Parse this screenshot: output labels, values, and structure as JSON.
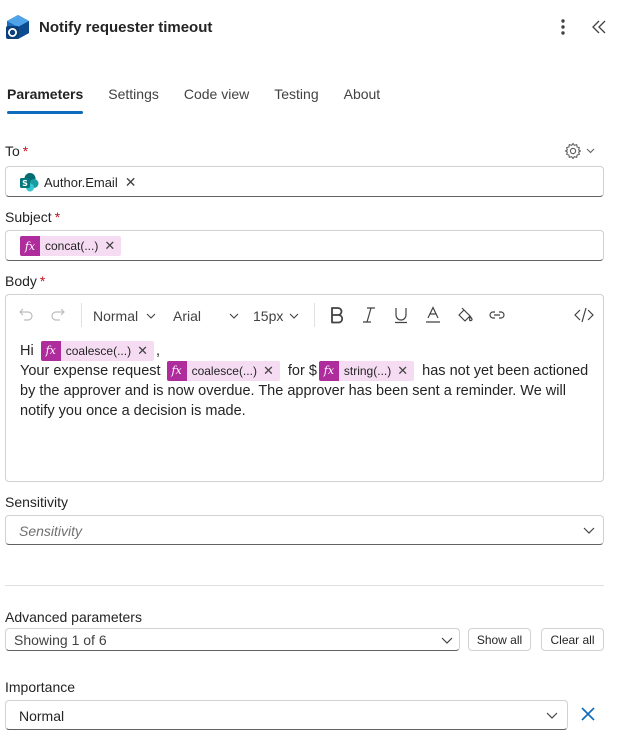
{
  "header": {
    "title": "Notify requester timeout"
  },
  "tabs": [
    {
      "label": "Parameters",
      "active": true
    },
    {
      "label": "Settings",
      "active": false
    },
    {
      "label": "Code view",
      "active": false
    },
    {
      "label": "Testing",
      "active": false
    },
    {
      "label": "About",
      "active": false
    }
  ],
  "to": {
    "label": "To",
    "required": "*",
    "token": "Author.Email"
  },
  "subject": {
    "label": "Subject",
    "required": "*",
    "token": "concat(...)"
  },
  "body": {
    "label": "Body",
    "required": "*",
    "toolbar": {
      "paragraph_style": "Normal",
      "font": "Arial",
      "font_size": "15px"
    },
    "line1_prefix": "Hi",
    "line1_token": "coalesce(...)",
    "line1_suffix": ",",
    "line2_prefix": "Your expense request",
    "line2_token1": "coalesce(...)",
    "line2_mid": "for $",
    "line2_token2": "string(...)",
    "line2_suffix": "has not yet been actioned",
    "line3": "by the approver and is now overdue. The approver has been sent a reminder. We will",
    "line4": "notify you once a decision is made."
  },
  "sensitivity": {
    "label": "Sensitivity",
    "placeholder": "Sensitivity"
  },
  "advanced": {
    "label": "Advanced parameters",
    "value": "Showing 1 of 6",
    "show_all": "Show all",
    "clear_all": "Clear all"
  },
  "importance": {
    "label": "Importance",
    "value": "Normal"
  },
  "colors": {
    "accent": "#0f6cbd",
    "token_bg": "#f5dcf2",
    "token_fx": "#ae2c9c",
    "required": "#c50f1f"
  },
  "icons": [
    "outlook-app-icon",
    "more-vertical-icon",
    "collapse-panel-icon",
    "settings-gear-icon",
    "sharepoint-icon",
    "fx-icon",
    "dismiss-icon",
    "undo-icon",
    "redo-icon",
    "chevron-down-icon",
    "bold-icon",
    "italic-icon",
    "underline-icon",
    "font-color-icon",
    "highlight-icon",
    "link-icon",
    "code-view-icon"
  ]
}
